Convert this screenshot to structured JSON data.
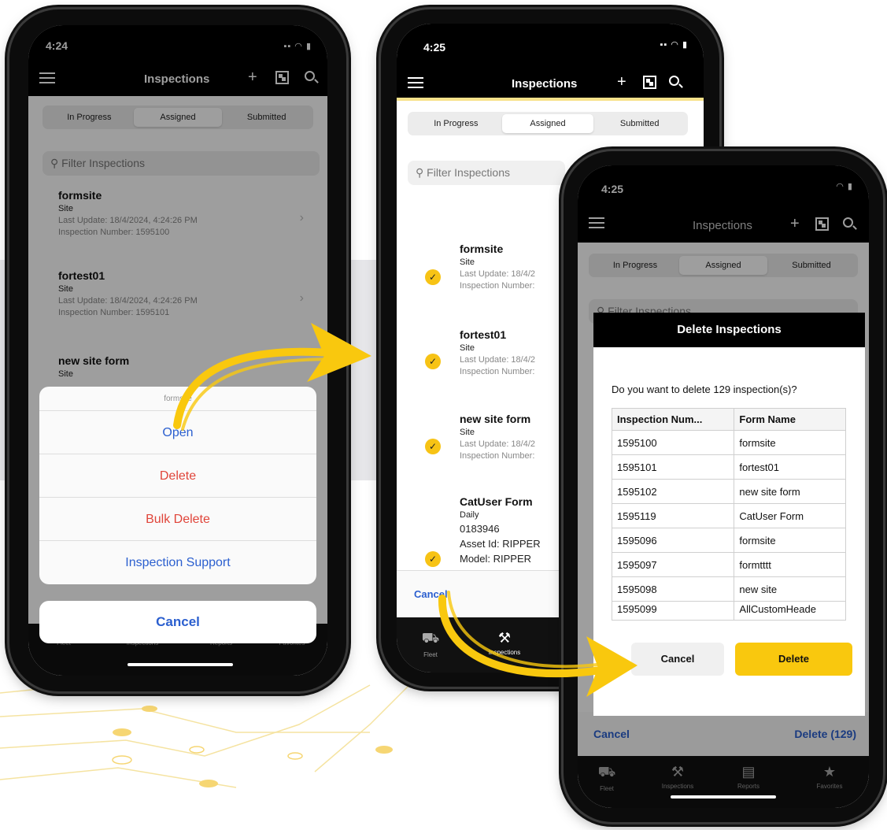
{
  "colors": {
    "accent": "#f9c80e",
    "link": "#2b5fcf",
    "danger": "#e0453a",
    "navbar": "#000000"
  },
  "phone1": {
    "time": "4:24",
    "title": "Inspections",
    "tabs": [
      "In Progress",
      "Assigned",
      "Submitted"
    ],
    "filter_placeholder": "Filter Inspections",
    "items": [
      {
        "title": "formsite",
        "type": "Site",
        "update": "Last Update: 18/4/2024, 4:24:26 PM",
        "number": "Inspection Number: 1595100"
      },
      {
        "title": "fortest01",
        "type": "Site",
        "update": "Last Update: 18/4/2024, 4:24:26 PM",
        "number": "Inspection Number: 1595101"
      },
      {
        "title": "new site form",
        "type": "Site"
      }
    ],
    "sheet": {
      "title": "formsite",
      "open": "Open",
      "delete": "Delete",
      "bulk_delete": "Bulk Delete",
      "support": "Inspection Support",
      "cancel": "Cancel"
    },
    "tabbar": [
      "Fleet",
      "Inspections",
      "Reports",
      "Favorites"
    ]
  },
  "phone2": {
    "time": "4:25",
    "title": "Inspections",
    "tabs": [
      "In Progress",
      "Assigned",
      "Submitted"
    ],
    "filter_placeholder": "Filter Inspections",
    "items": [
      {
        "title": "formsite",
        "type": "Site",
        "update": "Last Update: 18/4/2",
        "number": "Inspection Number:"
      },
      {
        "title": "fortest01",
        "type": "Site",
        "update": "Last Update: 18/4/2",
        "number": "Inspection Number:"
      },
      {
        "title": "new site form",
        "type": "Site",
        "update": "Last Update: 18/4/2",
        "number": "Inspection Number:"
      },
      {
        "title": "CatUser Form",
        "type": "Daily",
        "code": "0183946",
        "asset": "Asset Id: RIPPER",
        "model": "Model: RIPPER"
      }
    ],
    "cancel": "Cancel",
    "tabbar": [
      "Fleet",
      "Inspections"
    ]
  },
  "phone3": {
    "time": "4:25",
    "title": "Inspections",
    "tabs": [
      "In Progress",
      "Assigned",
      "Submitted"
    ],
    "filter_placeholder": "Filter Inspections",
    "dialog": {
      "title": "Delete Inspections",
      "message": "Do you want to delete 129 inspection(s)?",
      "headers": [
        "Inspection Num...",
        "Form Name"
      ],
      "rows": [
        [
          "1595100",
          "formsite"
        ],
        [
          "1595101",
          "fortest01"
        ],
        [
          "1595102",
          "new site form"
        ],
        [
          "1595119",
          "CatUser Form"
        ],
        [
          "1595096",
          "formsite"
        ],
        [
          "1595097",
          "formtttt"
        ],
        [
          "1595098",
          "new site"
        ],
        [
          "1595099",
          "AllCustomHeade"
        ]
      ],
      "cancel": "Cancel",
      "delete": "Delete"
    },
    "bottom_cancel": "Cancel",
    "bottom_delete": "Delete (129)",
    "tabbar": [
      "Fleet",
      "Inspections",
      "Reports",
      "Favorites"
    ]
  }
}
